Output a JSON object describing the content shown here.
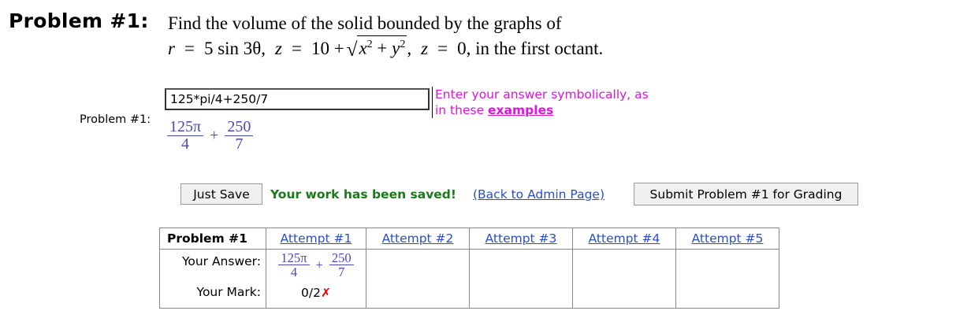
{
  "problem": {
    "heading": "Problem #1:",
    "statement_line1": "Find the volume of the solid bounded by the graphs of",
    "line2": {
      "r_var": "r",
      "eq": "=",
      "r_expr": "5 sin 3θ,",
      "z_var": "z",
      "z_expr_prefix": "10 +",
      "sqrt_x": "x",
      "sqrt_exp": "2",
      "sqrt_plus": "+",
      "sqrt_y": "y",
      "after_sqrt": ",",
      "z2_expr": "0, in the first octant."
    }
  },
  "answer": {
    "label": "Problem #1:",
    "value": "125*pi/4+250/7",
    "hint_text": "Enter your answer symbolically, as in these",
    "hint_link": "examples"
  },
  "preview": {
    "num1": "125π",
    "den1": "4",
    "op": "+",
    "num2": "250",
    "den2": "7"
  },
  "actions": {
    "save_label": "Just Save",
    "saved_message": "Your work has been saved!",
    "admin_link": "(Back to Admin Page)",
    "submit_label": "Submit Problem #1 for Grading"
  },
  "attempts_table": {
    "row_header": "Problem #1",
    "attempt_labels": [
      "Attempt #1",
      "Attempt #2",
      "Attempt #3",
      "Attempt #4",
      "Attempt #5"
    ],
    "your_answer_label": "Your Answer:",
    "your_mark_label": "Your Mark:",
    "attempt1_answer": {
      "num1": "125π",
      "den1": "4",
      "op": "+",
      "num2": "250",
      "den2": "7"
    },
    "attempt1_mark": "0/2",
    "attempt1_mark_icon": "✗"
  },
  "colors": {
    "hint": "#e012e0",
    "saved": "#1a7a1a",
    "link": "#2a4fc6",
    "math_preview": "#4a4ab8",
    "wrong_mark": "#e00000"
  }
}
